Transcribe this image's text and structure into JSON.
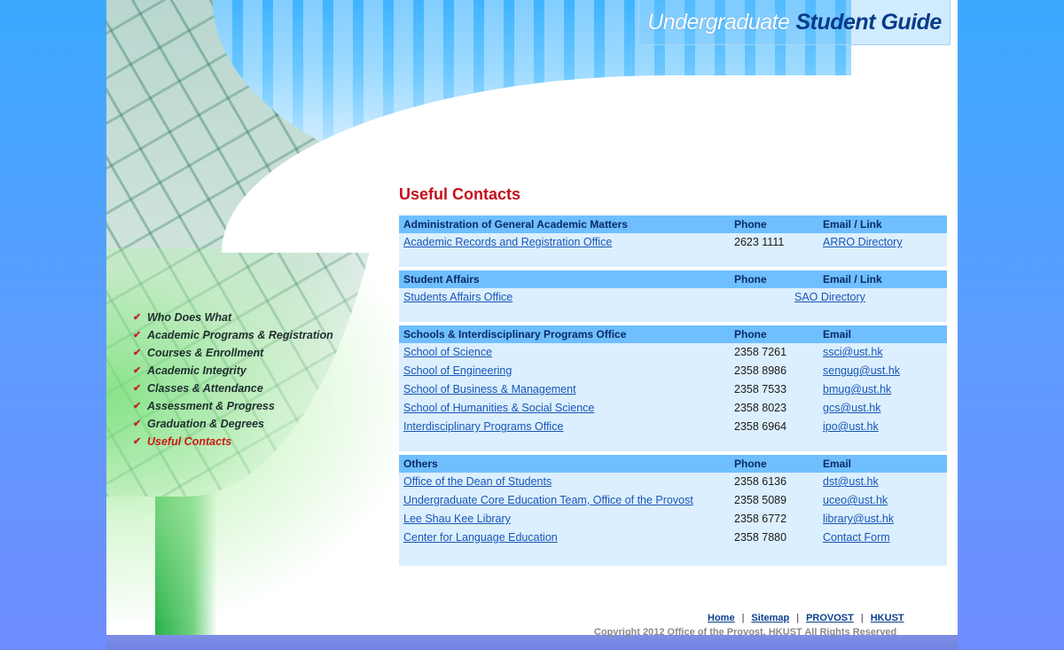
{
  "header": {
    "title_light": "Undergraduate",
    "title_bold": "Student Guide"
  },
  "nav": {
    "items": [
      {
        "label": "Who Does What",
        "active": false
      },
      {
        "label": "Academic Programs & Registration",
        "active": false
      },
      {
        "label": "Courses & Enrollment",
        "active": false
      },
      {
        "label": "Academic Integrity",
        "active": false
      },
      {
        "label": "Classes & Attendance",
        "active": false
      },
      {
        "label": "Assessment & Progress",
        "active": false
      },
      {
        "label": "Graduation & Degrees",
        "active": false
      },
      {
        "label": "Useful Contacts",
        "active": true
      }
    ],
    "check_glyph": "✔"
  },
  "main": {
    "heading": "Useful Contacts",
    "sections": [
      {
        "header": [
          "Administration of General Academic Matters",
          "Phone",
          "Email / Link"
        ],
        "rows": [
          [
            "Academic Records and Registration Office",
            "2623 1111",
            "ARRO Directory"
          ]
        ]
      },
      {
        "header": [
          "Student Affairs",
          "Phone",
          "Email / Link"
        ],
        "rows": [
          [
            "Students Affairs Office",
            "",
            "SAO Directory"
          ]
        ]
      },
      {
        "header": [
          "Schools & Interdisciplinary Programs Office",
          "Phone",
          "Email"
        ],
        "rows": [
          [
            "School of Science",
            "2358 7261",
            "ssci@ust.hk"
          ],
          [
            "School of Engineering",
            "2358 8986",
            "sengug@ust.hk"
          ],
          [
            "School of Business & Management",
            "2358 7533",
            "bmug@ust.hk"
          ],
          [
            "School of Humanities & Social Science",
            "2358 8023",
            "gcs@ust.hk"
          ],
          [
            "Interdisciplinary Programs Office",
            "2358 6964",
            "ipo@ust.hk"
          ]
        ]
      },
      {
        "header": [
          "Others",
          "Phone",
          "Email"
        ],
        "rows": [
          [
            "Office of the Dean of Students",
            "2358 6136",
            "dst@ust.hk"
          ],
          [
            "Undergraduate Core Education Team, Office of the Provost",
            "2358 5089",
            "uceo@ust.hk"
          ],
          [
            "Lee Shau Kee Library",
            "2358 6772",
            "library@ust.hk"
          ],
          [
            "Center for Language Education",
            "2358 7880",
            "Contact Form"
          ]
        ]
      }
    ]
  },
  "footer": {
    "links": [
      "Home",
      "Sitemap",
      "PROVOST",
      "HKUST"
    ],
    "separator": "|",
    "copyright": "Copyright 2012 Office of the Provost, HKUST   All Rights Reserved"
  }
}
